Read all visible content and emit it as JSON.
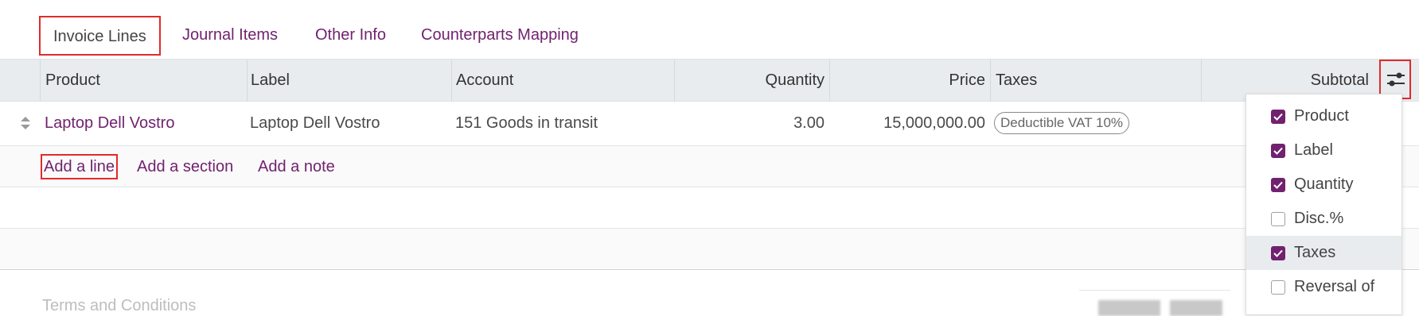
{
  "tabs": [
    {
      "label": "Invoice Lines",
      "active": true
    },
    {
      "label": "Journal Items"
    },
    {
      "label": "Other Info"
    },
    {
      "label": "Counterparts Mapping"
    }
  ],
  "table": {
    "headers": {
      "product": "Product",
      "label": "Label",
      "account": "Account",
      "quantity": "Quantity",
      "price": "Price",
      "taxes": "Taxes",
      "subtotal": "Subtotal"
    },
    "rows": [
      {
        "product": "Laptop Dell Vostro",
        "label": "Laptop Dell Vostro",
        "account": "151 Goods in transit",
        "quantity": "3.00",
        "price": "15,000,000.00",
        "tax_tag": "Deductible VAT 10%"
      }
    ],
    "actions": {
      "add_line": "Add a line",
      "add_section": "Add a section",
      "add_note": "Add a note"
    }
  },
  "footer": {
    "terms_placeholder": "Terms and Conditions"
  },
  "column_settings": {
    "icon": "sliders-icon",
    "options": [
      {
        "label": "Product",
        "checked": true
      },
      {
        "label": "Label",
        "checked": true
      },
      {
        "label": "Quantity",
        "checked": true
      },
      {
        "label": "Disc.%",
        "checked": false
      },
      {
        "label": "Taxes",
        "checked": true
      },
      {
        "label": "Reversal of",
        "checked": false
      }
    ]
  },
  "colors": {
    "accent": "#71226f",
    "highlight_border": "#e02b2b",
    "header_bg": "#e9ecef"
  }
}
